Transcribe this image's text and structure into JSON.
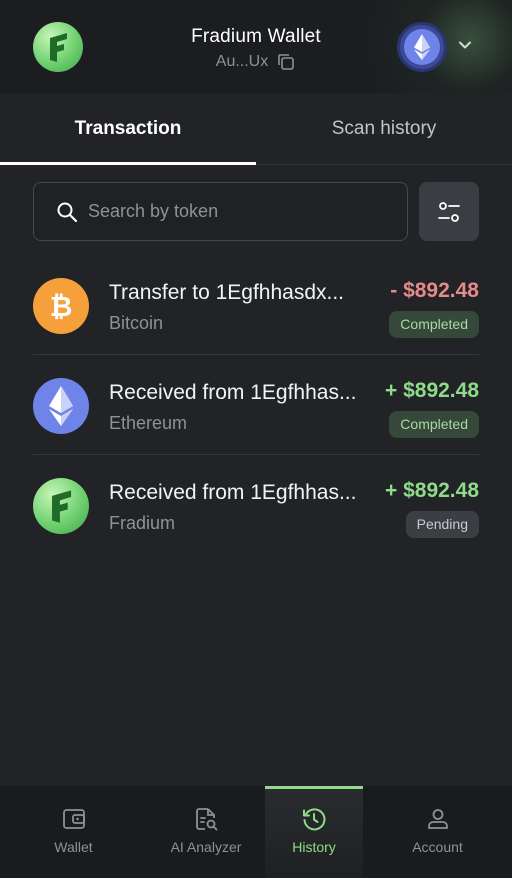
{
  "header": {
    "title": "Fradium Wallet",
    "address": "Au...Ux",
    "logo_icon": "fradium-logo-icon",
    "network_icon": "ethereum-icon"
  },
  "tabs": [
    {
      "label": "Transaction",
      "active": true
    },
    {
      "label": "Scan history",
      "active": false
    }
  ],
  "search": {
    "placeholder": "Search by token",
    "value": ""
  },
  "transactions": [
    {
      "title": "Transfer to 1Egfhhasdx...",
      "token": "Bitcoin",
      "amount": "- $892.48",
      "status": "Completed",
      "icon": "bitcoin-icon"
    },
    {
      "title": "Received from 1Egfhhas...",
      "token": "Ethereum",
      "amount": "+ $892.48",
      "status": "Completed",
      "icon": "ethereum-icon"
    },
    {
      "title": "Received from 1Egfhhas...",
      "token": "Fradium",
      "amount": "+ $892.48",
      "status": "Pending",
      "icon": "fradium-icon"
    }
  ],
  "nav": [
    {
      "label": "Wallet",
      "icon": "wallet-icon",
      "active": false
    },
    {
      "label": "AI Analyzer",
      "icon": "document-search-icon",
      "active": false
    },
    {
      "label": "History",
      "icon": "history-icon",
      "active": true
    },
    {
      "label": "Account",
      "icon": "user-icon",
      "active": false
    }
  ],
  "colors": {
    "background": "#212327",
    "accent_green": "#8fdb8a",
    "negative_red": "#e48b8b",
    "bitcoin_orange": "#f5a03a",
    "ethereum_blue": "#6f84e8"
  }
}
